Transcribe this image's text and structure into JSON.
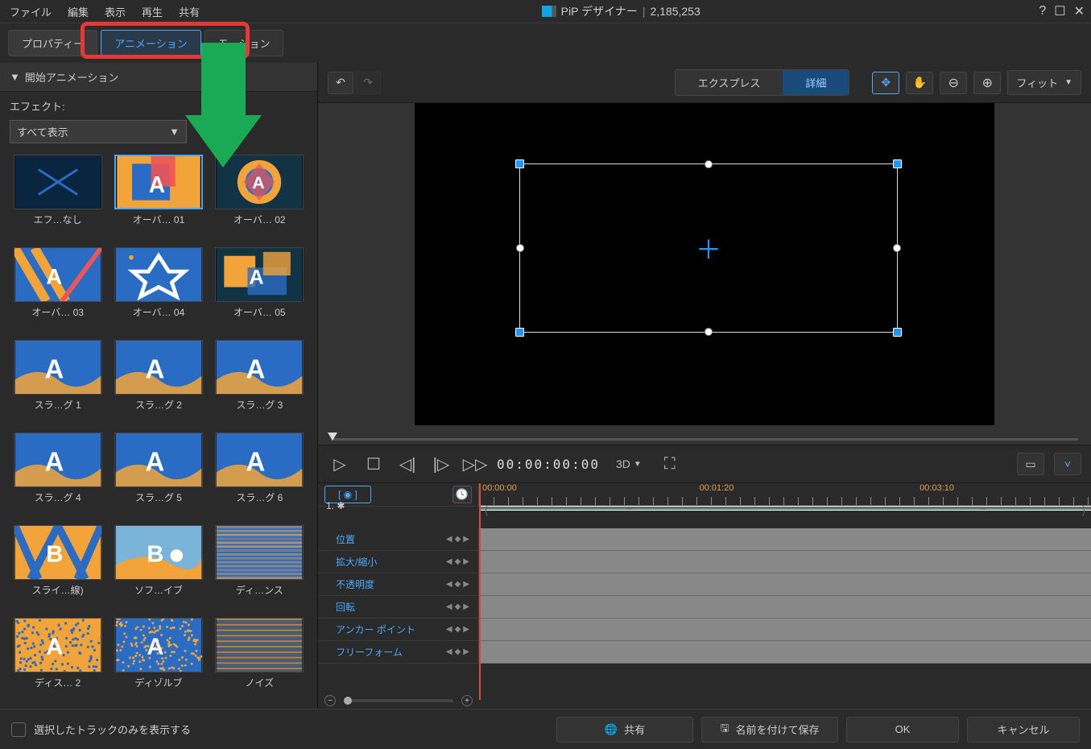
{
  "menubar": {
    "file": "ファイル",
    "edit": "編集",
    "view": "表示",
    "playback": "再生",
    "share": "共有"
  },
  "title": {
    "app": "PiP デザイナー",
    "sep": "|",
    "counter": "2,185,253"
  },
  "window": {
    "help": "?",
    "max": "☐",
    "close": "✕"
  },
  "tabs": {
    "properties": "プロパティー",
    "animation": "アニメーション",
    "motion": "モーション"
  },
  "section": {
    "start_anim": "開始アニメーション"
  },
  "effect": {
    "label": "エフェクト:",
    "dropdown": "すべて表示"
  },
  "thumbs": [
    {
      "name": "エフ…なし",
      "variant": "none"
    },
    {
      "name": "オーバ… 01",
      "variant": "overlap1",
      "selected": true
    },
    {
      "name": "オーバ… 02",
      "variant": "overlap2"
    },
    {
      "name": "オーバ… 03",
      "variant": "overlap3"
    },
    {
      "name": "オーバ… 04",
      "variant": "overlap4"
    },
    {
      "name": "オーバ… 05",
      "variant": "overlap5"
    },
    {
      "name": "スラ…グ 1",
      "variant": "slide1"
    },
    {
      "name": "スラ…グ 2",
      "variant": "slide2"
    },
    {
      "name": "スラ…グ 3",
      "variant": "slide3"
    },
    {
      "name": "スラ…グ 4",
      "variant": "slide4"
    },
    {
      "name": "スラ…グ 5",
      "variant": "slide5"
    },
    {
      "name": "スラ…グ 6",
      "variant": "slide6"
    },
    {
      "name": "スライ…線)",
      "variant": "slideline"
    },
    {
      "name": "ソフ…イブ",
      "variant": "softwipe"
    },
    {
      "name": "ディ…ンス",
      "variant": "distance"
    },
    {
      "name": "ディス… 2",
      "variant": "dissolve2"
    },
    {
      "name": "ディゾルブ",
      "variant": "dissolve"
    },
    {
      "name": "ノイズ",
      "variant": "noise"
    }
  ],
  "view_mode": {
    "express": "エクスプレス",
    "detail": "詳細"
  },
  "fit": "フィット",
  "timecode": "00:00:00:00",
  "d3": "3D",
  "tl": {
    "times": [
      "00:00:00",
      "00:01:20",
      "00:03:10"
    ],
    "main_label": "1.",
    "tracks": [
      "位置",
      "拡大/縮小",
      "不透明度",
      "回転",
      "アンカー ポイント",
      "フリーフォーム"
    ]
  },
  "footer": {
    "checkbox_label": "選択したトラックのみを表示する",
    "share": "共有",
    "saveas": "名前を付けて保存",
    "ok": "OK",
    "cancel": "キャンセル"
  }
}
